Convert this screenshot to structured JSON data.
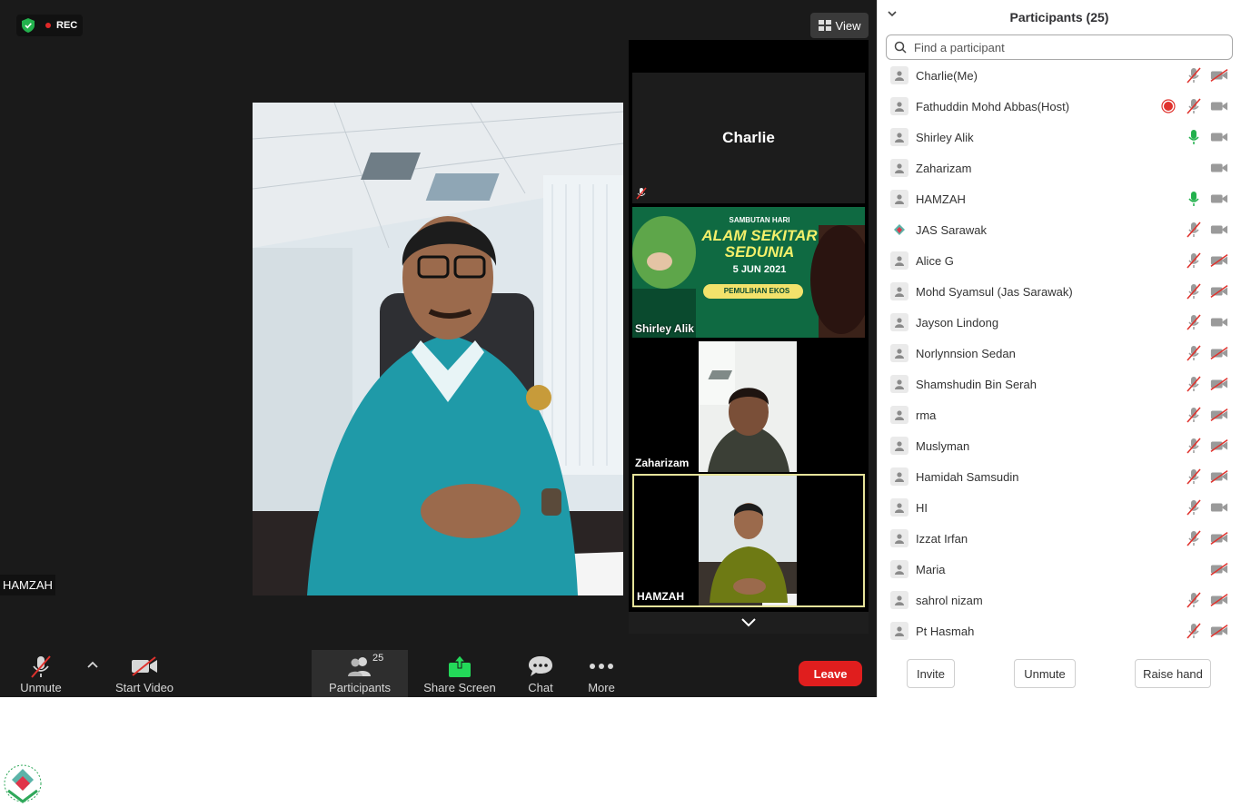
{
  "status": {
    "rec_label": "REC"
  },
  "view_button": {
    "label": "View"
  },
  "main_speaker": {
    "name": "HAMZAH"
  },
  "gallery": {
    "tiles": [
      {
        "name": "Charlie",
        "label": ""
      },
      {
        "name": "Shirley Alik",
        "banner_line1": "SAMBUTAN HARI",
        "banner_line2": "ALAM SEKITAR",
        "banner_line3": "SEDUNIA",
        "banner_date": "5 JUN 2021",
        "banner_sub": "PEMULIHAN EKOS"
      },
      {
        "name": "Zaharizam"
      },
      {
        "name": "HAMZAH"
      }
    ]
  },
  "toolbar": {
    "unmute": "Unmute",
    "start_video": "Start Video",
    "participants": "Participants",
    "participants_count": "25",
    "share_screen": "Share Screen",
    "chat": "Chat",
    "more": "More",
    "leave": "Leave"
  },
  "panel": {
    "title": "Participants (25)",
    "search_placeholder": "Find a participant",
    "participants": [
      {
        "name": "Charlie(Me)",
        "mic": "muted",
        "video": "off"
      },
      {
        "name": "Fathuddin Mohd Abbas(Host)",
        "mic": "muted",
        "video": "on",
        "recording": true
      },
      {
        "name": "Shirley Alik",
        "mic": "active",
        "video": "on"
      },
      {
        "name": "Zaharizam",
        "mic": "none",
        "video": "on"
      },
      {
        "name": "HAMZAH",
        "mic": "active",
        "video": "on"
      },
      {
        "name": "JAS Sarawak",
        "mic": "muted",
        "video": "on",
        "avatar": "logo"
      },
      {
        "name": "Alice G",
        "mic": "muted",
        "video": "off"
      },
      {
        "name": "Mohd Syamsul (Jas Sarawak)",
        "mic": "muted",
        "video": "off"
      },
      {
        "name": "Jayson Lindong",
        "mic": "muted",
        "video": "on"
      },
      {
        "name": "Norlynnsion Sedan",
        "mic": "muted",
        "video": "off"
      },
      {
        "name": "Shamshudin Bin Serah",
        "mic": "muted",
        "video": "off"
      },
      {
        "name": "rma",
        "mic": "muted",
        "video": "off"
      },
      {
        "name": "Muslyman",
        "mic": "muted",
        "video": "off"
      },
      {
        "name": "Hamidah Samsudin",
        "mic": "muted",
        "video": "off"
      },
      {
        "name": "HI",
        "mic": "muted",
        "video": "on"
      },
      {
        "name": "Izzat Irfan",
        "mic": "muted",
        "video": "off"
      },
      {
        "name": "Maria",
        "mic": "none",
        "video": "off"
      },
      {
        "name": "sahrol nizam",
        "mic": "muted",
        "video": "off"
      },
      {
        "name": "Pt Hasmah",
        "mic": "muted",
        "video": "off"
      }
    ],
    "footer": {
      "invite": "Invite",
      "unmute": "Unmute",
      "raise_hand": "Raise hand"
    }
  },
  "colors": {
    "leave": "#e01e1e",
    "share": "#23d959",
    "mic_active": "#23b14d",
    "muted_red": "#e0322d",
    "highlight": "#e6e39a"
  }
}
